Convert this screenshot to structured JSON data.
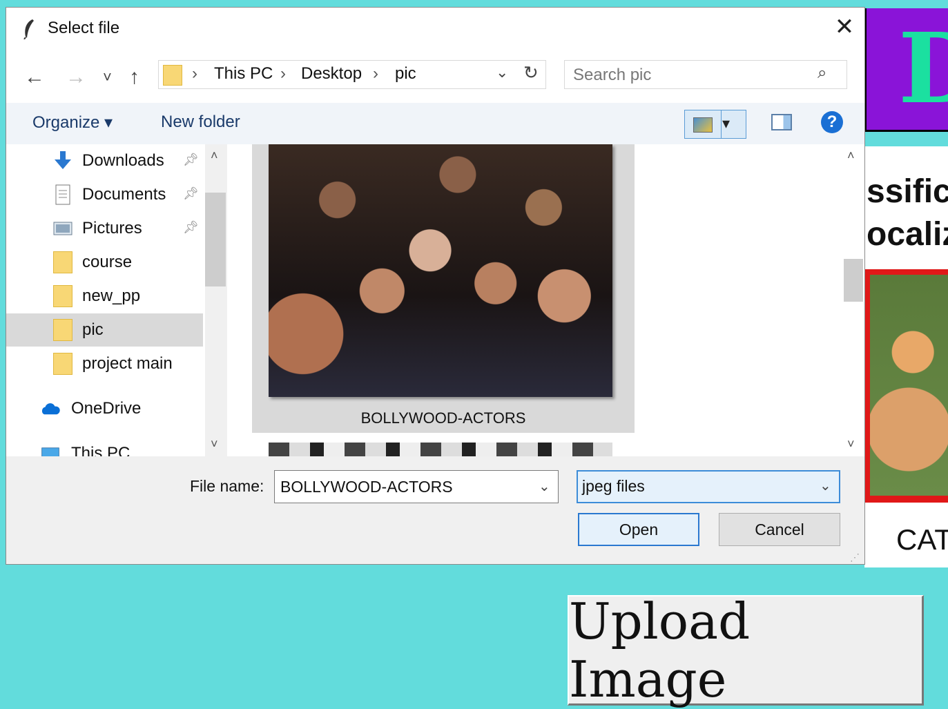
{
  "dialog": {
    "title": "Select file",
    "nav": {
      "back": "←",
      "forward": "→",
      "recent": "˅",
      "up": "↑"
    },
    "address": {
      "crumbs": [
        "This PC",
        "Desktop",
        "pic"
      ],
      "separator": "›"
    },
    "search": {
      "placeholder": "Search pic"
    },
    "toolbar": {
      "organize_label": "Organize ▾",
      "new_folder_label": "New folder",
      "help_label": "?"
    },
    "nav_pane": {
      "items": [
        {
          "label": "Downloads",
          "icon": "download-icon",
          "pinned": true
        },
        {
          "label": "Documents",
          "icon": "documents-icon",
          "pinned": true
        },
        {
          "label": "Pictures",
          "icon": "pictures-icon",
          "pinned": true
        },
        {
          "label": "course",
          "icon": "folder-icon"
        },
        {
          "label": "new_pp",
          "icon": "folder-icon"
        },
        {
          "label": "pic",
          "icon": "folder-icon",
          "selected": true
        },
        {
          "label": "project main",
          "icon": "folder-icon"
        },
        {
          "label": "OneDrive",
          "icon": "cloud-icon"
        },
        {
          "label": "This PC",
          "icon": "computer-icon"
        }
      ]
    },
    "content": {
      "items": [
        {
          "label": "BOLLYWOOD-ACTORS",
          "selected": true
        }
      ]
    },
    "footer": {
      "filename_label": "File name:",
      "filename_value": "BOLLYWOOD-ACTORS",
      "filetype_value": "jpeg files",
      "open_label": "Open",
      "cancel_label": "Cancel"
    }
  },
  "background_app": {
    "header_text": "D",
    "text_line_1": "ssific",
    "text_line_2": "ocaliz",
    "cat_label": "CAT",
    "upload_button_label": "Upload Image"
  },
  "colors": {
    "app_background": "#62dcdc",
    "header_purple": "#8a14d8",
    "header_text": "#1be0a0",
    "cat_frame": "#e01818",
    "accent_blue": "#2a78d0"
  }
}
